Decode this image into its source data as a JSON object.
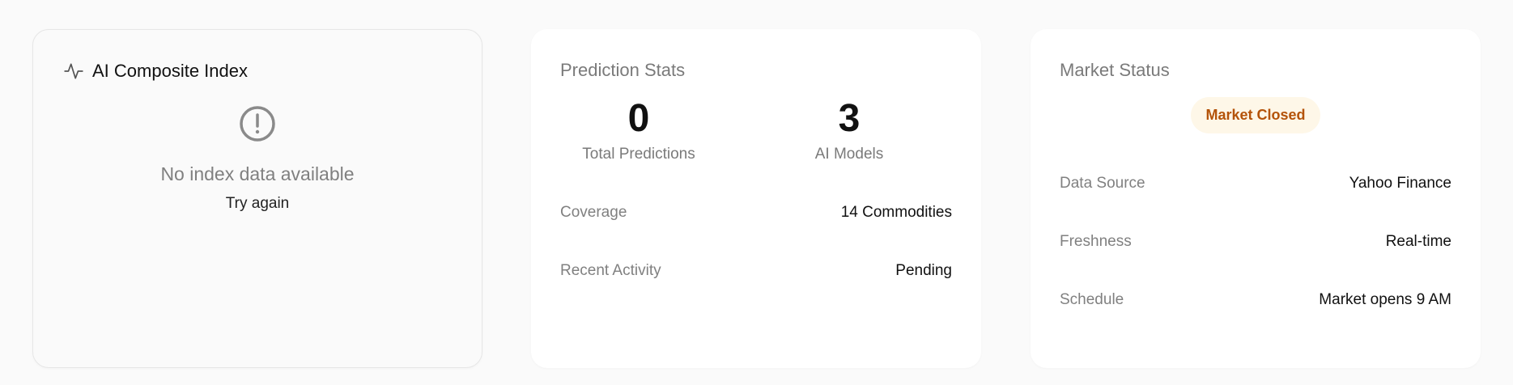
{
  "index_card": {
    "title": "AI Composite Index",
    "title_icon": "activity-pulse-icon",
    "empty_icon": "alert-circle-icon",
    "empty_message": "No index data available",
    "retry_label": "Try again"
  },
  "stats_card": {
    "title": "Prediction Stats",
    "stats": [
      {
        "value": "0",
        "label": "Total Predictions"
      },
      {
        "value": "3",
        "label": "AI Models"
      }
    ],
    "rows": [
      {
        "key": "Coverage",
        "value": "14 Commodities"
      },
      {
        "key": "Recent Activity",
        "value": "Pending"
      }
    ]
  },
  "market_card": {
    "title": "Market Status",
    "badge": "Market Closed",
    "badge_color": "#b45309",
    "badge_bg": "#fef7e8",
    "rows": [
      {
        "key": "Data Source",
        "value": "Yahoo Finance"
      },
      {
        "key": "Freshness",
        "value": "Real-time"
      },
      {
        "key": "Schedule",
        "value": "Market opens 9 AM"
      }
    ]
  }
}
